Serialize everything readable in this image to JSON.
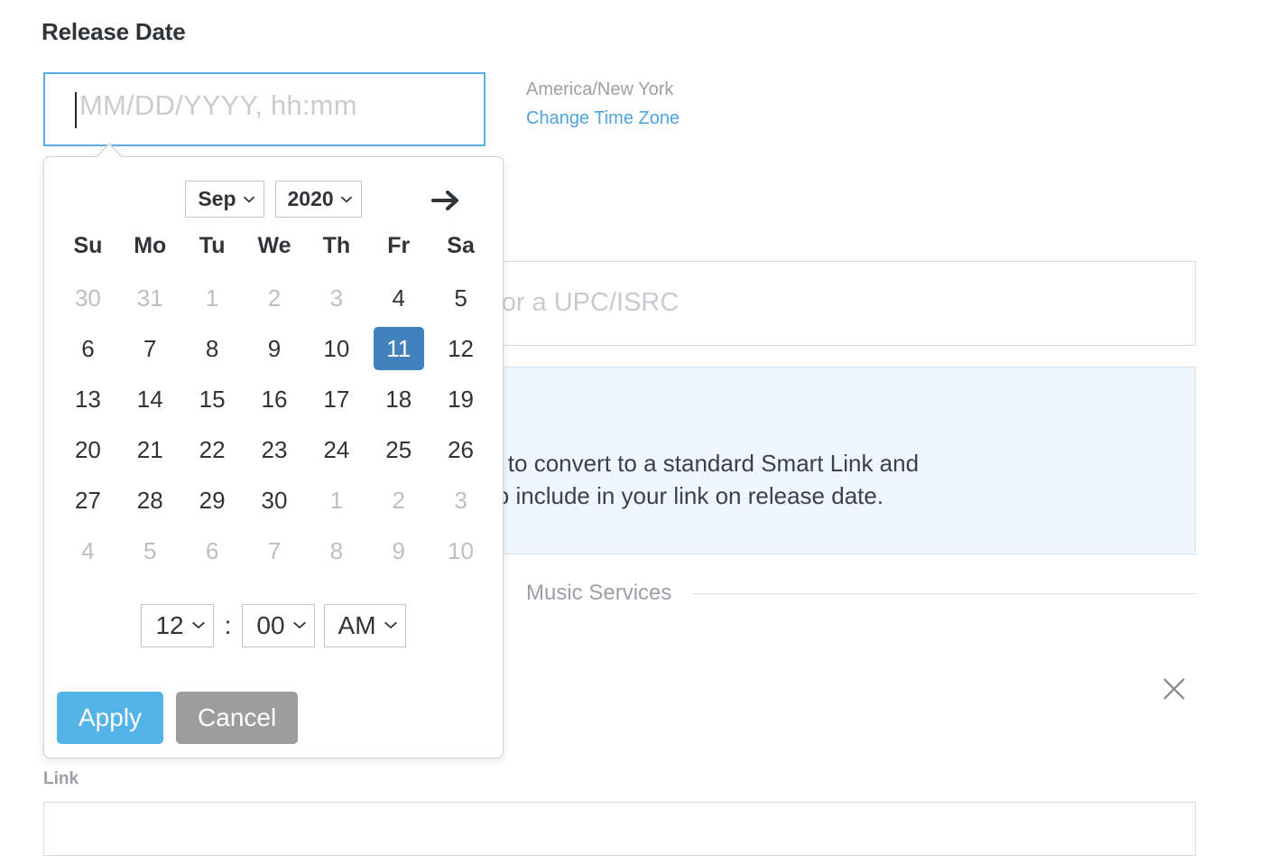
{
  "form": {
    "release_date_label": "Release Date",
    "date_placeholder": "MM/DD/YYYY, hh:mm",
    "date_value": "",
    "link_label": "Link",
    "link_value": ""
  },
  "timezone": {
    "current": "America/New York",
    "change_link": "Change Time Zone"
  },
  "search": {
    "placeholder": "playlist or a UPC/ISRC",
    "value": ""
  },
  "info_box": {
    "line1": "r this link to convert to a standard Smart Link and",
    "line2": "ervices to include in your link on release date.",
    "background": "#eff6fc",
    "border": "#cfe3f3"
  },
  "music_services": {
    "caption": "Music Services"
  },
  "icons": {
    "close": "close-icon",
    "next_month": "arrow-right-icon",
    "chevron": "chevron-down-icon"
  },
  "datepicker": {
    "month": "Sep",
    "year": "2020",
    "next_label": "→",
    "weekdays": [
      "Su",
      "Mo",
      "Tu",
      "We",
      "Th",
      "Fr",
      "Sa"
    ],
    "selected_day": 11,
    "weeks": [
      [
        {
          "n": "30",
          "muted": true
        },
        {
          "n": "31",
          "muted": true
        },
        {
          "n": "1",
          "muted": true
        },
        {
          "n": "2",
          "muted": true
        },
        {
          "n": "3",
          "muted": true
        },
        {
          "n": "4",
          "muted": false
        },
        {
          "n": "5",
          "muted": false
        }
      ],
      [
        {
          "n": "6",
          "muted": false
        },
        {
          "n": "7",
          "muted": false
        },
        {
          "n": "8",
          "muted": false
        },
        {
          "n": "9",
          "muted": false
        },
        {
          "n": "10",
          "muted": false
        },
        {
          "n": "11",
          "muted": false,
          "selected": true
        },
        {
          "n": "12",
          "muted": false
        }
      ],
      [
        {
          "n": "13",
          "muted": false
        },
        {
          "n": "14",
          "muted": false
        },
        {
          "n": "15",
          "muted": false
        },
        {
          "n": "16",
          "muted": false
        },
        {
          "n": "17",
          "muted": false
        },
        {
          "n": "18",
          "muted": false
        },
        {
          "n": "19",
          "muted": false
        }
      ],
      [
        {
          "n": "20",
          "muted": false
        },
        {
          "n": "21",
          "muted": false
        },
        {
          "n": "22",
          "muted": false
        },
        {
          "n": "23",
          "muted": false
        },
        {
          "n": "24",
          "muted": false
        },
        {
          "n": "25",
          "muted": false
        },
        {
          "n": "26",
          "muted": false
        }
      ],
      [
        {
          "n": "27",
          "muted": false
        },
        {
          "n": "28",
          "muted": false
        },
        {
          "n": "29",
          "muted": false
        },
        {
          "n": "30",
          "muted": false
        },
        {
          "n": "1",
          "muted": true
        },
        {
          "n": "2",
          "muted": true
        },
        {
          "n": "3",
          "muted": true
        }
      ],
      [
        {
          "n": "4",
          "muted": true
        },
        {
          "n": "5",
          "muted": true
        },
        {
          "n": "6",
          "muted": true
        },
        {
          "n": "7",
          "muted": true
        },
        {
          "n": "8",
          "muted": true
        },
        {
          "n": "9",
          "muted": true
        },
        {
          "n": "10",
          "muted": true
        }
      ]
    ],
    "time": {
      "hour": "12",
      "separator": ":",
      "minute": "00",
      "meridiem": "AM"
    },
    "apply_label": "Apply",
    "cancel_label": "Cancel",
    "colors": {
      "selected_day": "#4182bd",
      "apply": "#54b4e8",
      "cancel": "#9d9d9d",
      "focus_border": "#5aabde",
      "link": "#4ea3dd"
    }
  }
}
